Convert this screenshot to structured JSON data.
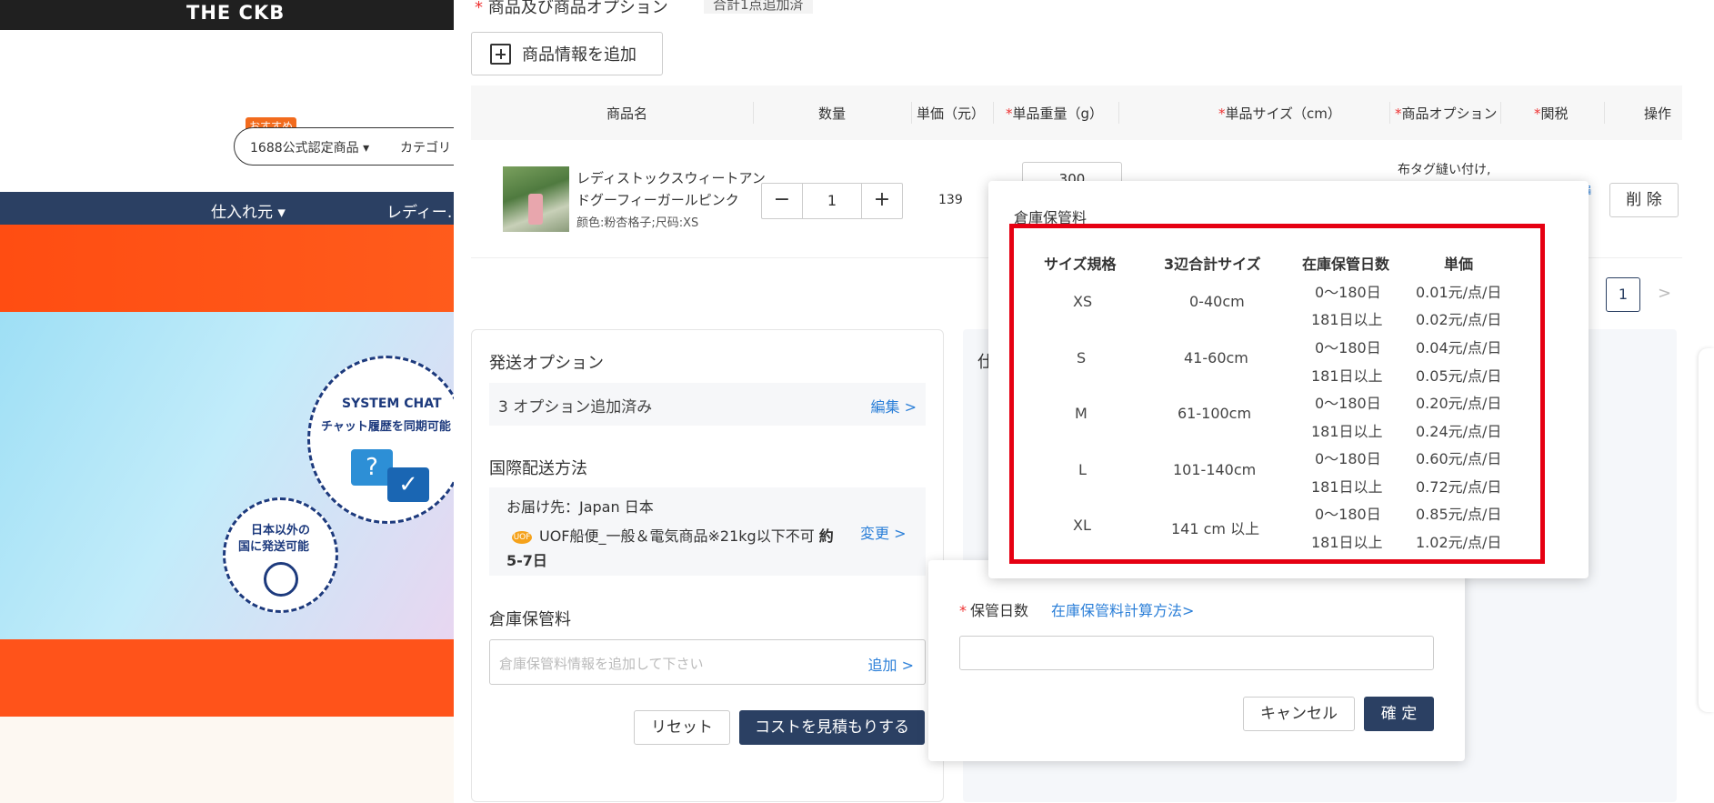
{
  "bg": {
    "logo": "THE CKB",
    "badge": "おすすめ",
    "search_select": "1688公式認定商品 ▾",
    "search_category": "カテゴリ",
    "nav_items": [
      "仕入れ元 ▾",
      "レディー…"
    ],
    "bubble1_title": "SYSTEM CHAT",
    "bubble1_sub": "チャット履歴を同期可能",
    "bubble2_line1": "日本以外の",
    "bubble2_line2": "国に発送可能"
  },
  "drawer": {
    "heading": "商品及び商品オプション",
    "count": "合計1点追加済",
    "add_product": "商品情報を追加",
    "columns": {
      "name": "商品名",
      "qty": "数量",
      "price": "単価（元）",
      "weight": "単品重量（g）",
      "size": "単品サイズ（cm）",
      "option": "商品オプション",
      "tax": "関税",
      "action": "操作"
    },
    "row": {
      "name": "レディストックスウィートアンドグーフィーガールピンク",
      "attr": "颜色:粉杏格子;尺码:XS",
      "qty": "1",
      "minus": "−",
      "plus": "+",
      "price": "139",
      "weight": "300",
      "option": "布タグ縫い付け,",
      "edit": "編\n>",
      "delete": "削 除"
    },
    "pager_current": "1",
    "pager_next": ">",
    "shipping": {
      "title": "発送オプション",
      "options_text": "3 オプション追加済み",
      "options_edit": "編集 >",
      "intl_title": "国際配送方法",
      "dest": "お届け先：Japan 日本",
      "method_icon": "UOF",
      "method": "UOF船便_一般＆電気商品※21kg以下不可",
      "method_est": "約",
      "days": "5-7日",
      "change": "変更 >",
      "storage_title": "倉庫保管料",
      "storage_placeholder": "倉庫保管料情報を追加して下さい",
      "storage_add": "追加 >",
      "reset": "リセット",
      "estimate": "コストを見積もりする"
    },
    "right_title": "仕"
  },
  "days_popover": {
    "label": "保管日数",
    "link": "在庫保管料計算方法>",
    "cancel": "キャンセル",
    "ok": "確 定"
  },
  "fee_table": {
    "title": "倉庫保管料",
    "headers": [
      "サイズ規格",
      "3辺合計サイズ",
      "在庫保管日数",
      "単価"
    ],
    "rows": [
      {
        "size": "XS",
        "range": "0-40cm",
        "tiers": [
          {
            "days": "0〜180日",
            "price": "0.01元/点/日"
          },
          {
            "days": "181日以上",
            "price": "0.02元/点/日"
          }
        ]
      },
      {
        "size": "S",
        "range": "41-60cm",
        "tiers": [
          {
            "days": "0〜180日",
            "price": "0.04元/点/日"
          },
          {
            "days": "181日以上",
            "price": "0.05元/点/日"
          }
        ]
      },
      {
        "size": "M",
        "range": "61-100cm",
        "tiers": [
          {
            "days": "0〜180日",
            "price": "0.20元/点/日"
          },
          {
            "days": "181日以上",
            "price": "0.24元/点/日"
          }
        ]
      },
      {
        "size": "L",
        "range": "101-140cm",
        "tiers": [
          {
            "days": "0〜180日",
            "price": "0.60元/点/日"
          },
          {
            "days": "181日以上",
            "price": "0.72元/点/日"
          }
        ]
      },
      {
        "size": "XL",
        "range": "141 cm 以上",
        "tiers": [
          {
            "days": "0〜180日",
            "price": "0.85元/点/日"
          },
          {
            "days": "181日以上",
            "price": "1.02元/点/日"
          }
        ]
      }
    ]
  },
  "colors": {
    "accent_navy": "#2b4063",
    "link_blue": "#2b7fd8",
    "highlight_red": "#e60012",
    "required_red": "#e33"
  }
}
